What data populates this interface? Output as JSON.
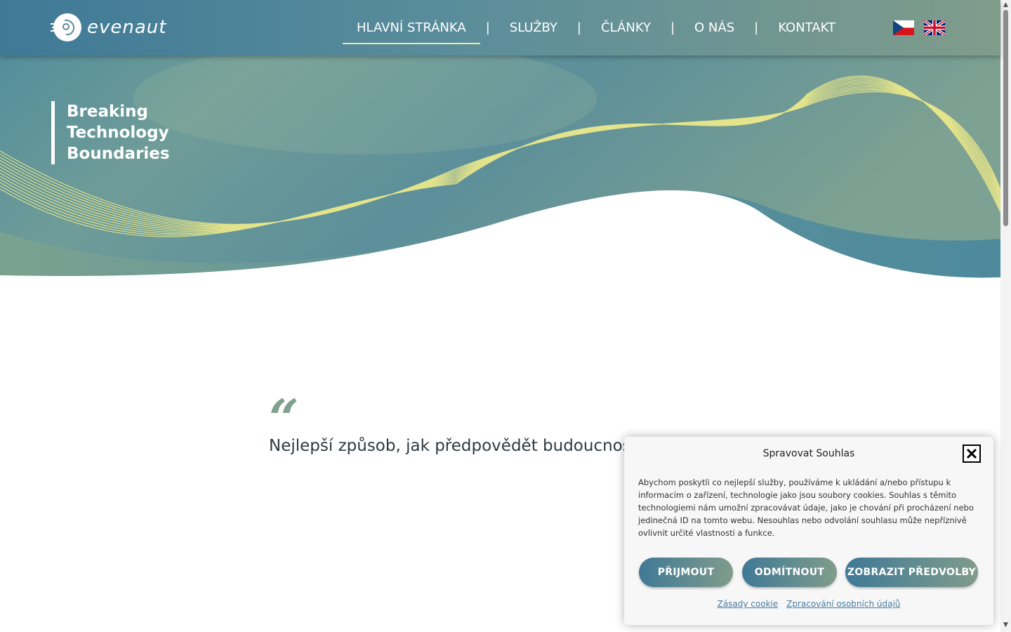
{
  "header": {
    "logo_text": "evenaut",
    "nav": [
      {
        "label": "HLAVNÍ STRÁNKA",
        "active": true
      },
      {
        "label": "SLUŽBY"
      },
      {
        "label": "ČLÁNKY"
      },
      {
        "label": "O NÁS"
      },
      {
        "label": "KONTAKT"
      }
    ],
    "nav_separator": "|",
    "languages": [
      "cs-flag-icon",
      "uk-flag-icon"
    ]
  },
  "hero": {
    "tagline_lines": [
      "Breaking",
      "Technology",
      "Boundaries"
    ]
  },
  "quote": {
    "mark": "“",
    "text": "Nejlepší způsob, jak předpovědět budoucnost"
  },
  "cookie_banner": {
    "title": "Spravovat Souhlas",
    "body": "Abychom poskytli co nejlepší služby, používáme k ukládání a/nebo přístupu k informacím o zařízení, technologie jako jsou soubory cookies. Souhlas s těmito technologiemi nám umožní zpracovávat údaje, jako je chování při procházení nebo jedinečná ID na tomto webu. Nesouhlas nebo odvolání souhlasu může nepříznivě ovlivnit určité vlastnosti a funkce.",
    "buttons": {
      "accept": "PŘIJMOUT",
      "deny": "ODMÍTNOUT",
      "preferences": "ZOBRAZIT PŘEDVOLBY"
    },
    "links": {
      "cookie_policy": "Zásady cookie",
      "privacy": "Zpracování osobních údajů"
    }
  },
  "colors": {
    "header_start": "#3f7996",
    "header_end": "#809c8b",
    "accent_yellow": "#e7eaa2",
    "quote_mark": "#7fa08e"
  }
}
